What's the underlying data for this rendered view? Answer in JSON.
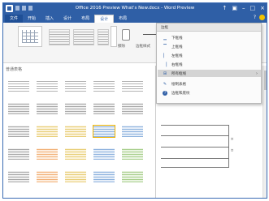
{
  "window": {
    "title": "Office 2016 Preview What's New.docx - Word Preview",
    "controls": [
      "↑",
      "▣",
      "–",
      "□",
      "×"
    ]
  },
  "tabs": [
    {
      "label": "文件",
      "kind": "file"
    },
    {
      "label": "开始",
      "kind": "normal"
    },
    {
      "label": "插入",
      "kind": "normal"
    },
    {
      "label": "设计",
      "kind": "normal"
    },
    {
      "label": "布局",
      "kind": "normal"
    },
    {
      "label": "设计",
      "kind": "active"
    },
    {
      "label": "布局",
      "kind": "normal"
    }
  ],
  "ribbon": {
    "tool_label_1": "擦除",
    "tool_label_2": "边框样式"
  },
  "gallery": {
    "label": "普通表格"
  },
  "menu": {
    "header": "边框",
    "items": [
      {
        "label": "下框线",
        "icon": "bottom-border-icon",
        "glyph": "▁"
      },
      {
        "label": "上框线",
        "icon": "top-border-icon",
        "glyph": "▔"
      },
      {
        "label": "左框线",
        "icon": "left-border-icon",
        "glyph": "▏"
      },
      {
        "label": "右框线",
        "icon": "right-border-icon",
        "glyph": "▕"
      },
      {
        "label": "所有框线",
        "icon": "all-borders-icon",
        "glyph": "⊞",
        "highlight": true,
        "arrow": true
      },
      {
        "label": "绘制表格",
        "icon": "draw-table-icon",
        "glyph": "✎"
      },
      {
        "label": "边框和底纹",
        "icon": "borders-shading-icon",
        "glyph": "?"
      }
    ]
  },
  "colors": {
    "title_bar": "#2f5fa6",
    "menu_highlight": "#d4d4d4",
    "selection_outline": "#f0b400"
  }
}
